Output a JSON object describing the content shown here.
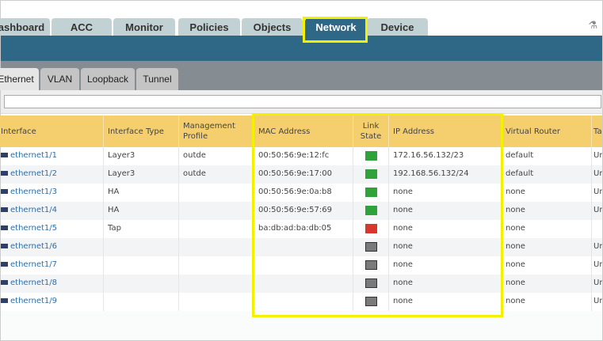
{
  "top_tabs": [
    {
      "label": "ashboard"
    },
    {
      "label": "ACC"
    },
    {
      "label": "Monitor"
    },
    {
      "label": "Policies"
    },
    {
      "label": "Objects"
    },
    {
      "label": "Network",
      "active": true
    },
    {
      "label": "Device"
    }
  ],
  "sub_tabs": [
    {
      "label": "Ethernet",
      "active": true
    },
    {
      "label": "VLAN"
    },
    {
      "label": "Loopback"
    },
    {
      "label": "Tunnel"
    }
  ],
  "filter": {
    "value": ""
  },
  "columns": [
    "Interface",
    "Interface Type",
    "Management Profile",
    "MAC Address",
    "Link State",
    "IP Address",
    "Virtual Router",
    "Tag"
  ],
  "link_colors": {
    "up": "#2fa33a",
    "down": "#d9372c",
    "unknown": "#7a7a7a"
  },
  "highlight_color": "#f4f100",
  "rows": [
    {
      "iface": "ethernet1/1",
      "type": "Layer3",
      "profile": "outde",
      "mac": "00:50:56:9e:12:fc",
      "link": "up",
      "ip": "172.16.56.132/23",
      "vr": "default",
      "tag": "Untagged"
    },
    {
      "iface": "ethernet1/2",
      "type": "Layer3",
      "profile": "outde",
      "mac": "00:50:56:9e:17:00",
      "link": "up",
      "ip": "192.168.56.132/24",
      "vr": "default",
      "tag": "Untagged"
    },
    {
      "iface": "ethernet1/3",
      "type": "HA",
      "profile": "",
      "mac": "00:50:56:9e:0a:b8",
      "link": "up",
      "ip": "none",
      "vr": "none",
      "tag": "Untagged"
    },
    {
      "iface": "ethernet1/4",
      "type": "HA",
      "profile": "",
      "mac": "00:50:56:9e:57:69",
      "link": "up",
      "ip": "none",
      "vr": "none",
      "tag": "Untagged"
    },
    {
      "iface": "ethernet1/5",
      "type": "Tap",
      "profile": "",
      "mac": "ba:db:ad:ba:db:05",
      "link": "down",
      "ip": "none",
      "vr": "none",
      "tag": ""
    },
    {
      "iface": "ethernet1/6",
      "type": "",
      "profile": "",
      "mac": "",
      "link": "unknown",
      "ip": "none",
      "vr": "none",
      "tag": "Untagged"
    },
    {
      "iface": "ethernet1/7",
      "type": "",
      "profile": "",
      "mac": "",
      "link": "unknown",
      "ip": "none",
      "vr": "none",
      "tag": "Untagged"
    },
    {
      "iface": "ethernet1/8",
      "type": "",
      "profile": "",
      "mac": "",
      "link": "unknown",
      "ip": "none",
      "vr": "none",
      "tag": "Untagged"
    },
    {
      "iface": "ethernet1/9",
      "type": "",
      "profile": "",
      "mac": "",
      "link": "unknown",
      "ip": "none",
      "vr": "none",
      "tag": "Untagged"
    }
  ]
}
